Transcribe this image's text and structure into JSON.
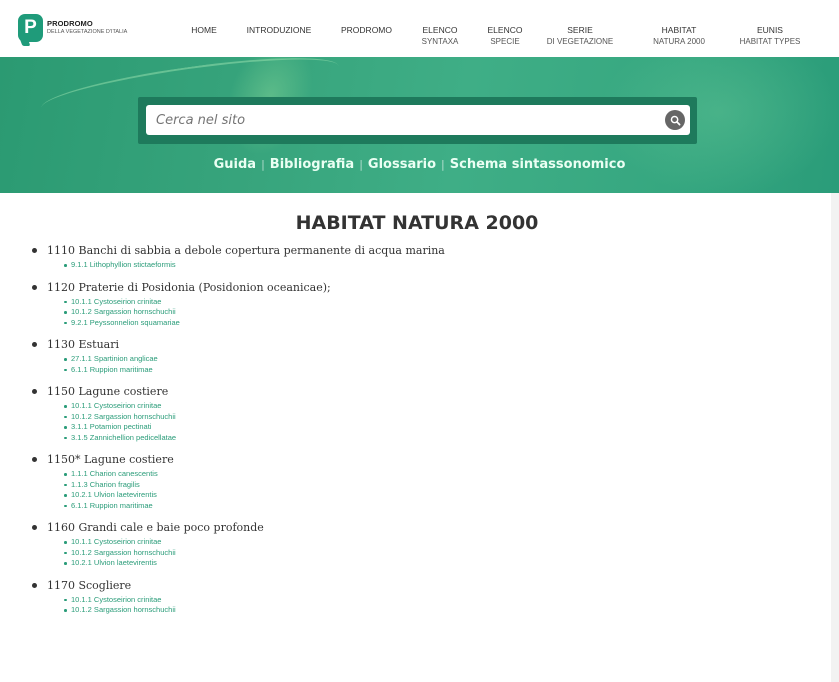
{
  "header": {
    "logo_letter": "P",
    "logo_title": "PRODROMO",
    "logo_subtitle": "DELLA VEGETAZIONE D'ITALIA",
    "nav": [
      {
        "line1": "HOME",
        "line2": ""
      },
      {
        "line1": "INTRODUZIONE",
        "line2": ""
      },
      {
        "line1": "PRODROMO",
        "line2": ""
      },
      {
        "line1": "ELENCO",
        "line2": "SYNTAXA"
      },
      {
        "line1": "ELENCO",
        "line2": "SPECIE"
      },
      {
        "line1": "SERIE",
        "line2": "DI VEGETAZIONE"
      },
      {
        "line1": "HABITAT",
        "line2": "NATURA 2000"
      },
      {
        "line1": "EUNIS",
        "line2": "HABITAT TYPES"
      }
    ]
  },
  "search": {
    "placeholder": "Cerca nel sito",
    "icon": "search-icon"
  },
  "hero_links": [
    "Guida",
    "Bibliografia",
    "Glossario",
    "Schema sintassonomico"
  ],
  "page_title": "HABITAT NATURA 2000",
  "colors": {
    "brand_green": "#2a9c79",
    "hero_green": "#37a47c",
    "search_frame": "#1e7a5c"
  },
  "habitats": [
    {
      "name": "1110 Banchi di sabbia a debole copertura permanente di acqua marina",
      "items": [
        "9.1.1 Lithophyllion stictaeformis"
      ]
    },
    {
      "name": "1120 Praterie di Posidonia (Posidonion oceanicae);",
      "items": [
        "10.1.1 Cystoseirion crinitae",
        "10.1.2 Sargassion hornschuchii",
        "9.2.1 Peyssonnelion squamariae"
      ]
    },
    {
      "name": "1130 Estuari",
      "items": [
        "27.1.1 Spartinion anglicae",
        "6.1.1 Ruppion maritimae"
      ]
    },
    {
      "name": "1150 Lagune costiere",
      "items": [
        "10.1.1 Cystoseirion crinitae",
        "10.1.2 Sargassion hornschuchii",
        "3.1.1 Potamion pectinati",
        "3.1.5 Zannichellion pedicellatae"
      ]
    },
    {
      "name": "1150* Lagune costiere",
      "items": [
        "1.1.1 Charion canescentis",
        "1.1.3 Charion fragilis",
        "10.2.1 Ulvion laetevirentis",
        "6.1.1 Ruppion maritimae"
      ]
    },
    {
      "name": "1160 Grandi cale e baie poco profonde",
      "items": [
        "10.1.1 Cystoseirion crinitae",
        "10.1.2 Sargassion hornschuchii",
        "10.2.1 Ulvion laetevirentis"
      ]
    },
    {
      "name": "1170 Scogliere",
      "items": [
        "10.1.1 Cystoseirion crinitae",
        "10.1.2 Sargassion hornschuchii"
      ]
    }
  ]
}
